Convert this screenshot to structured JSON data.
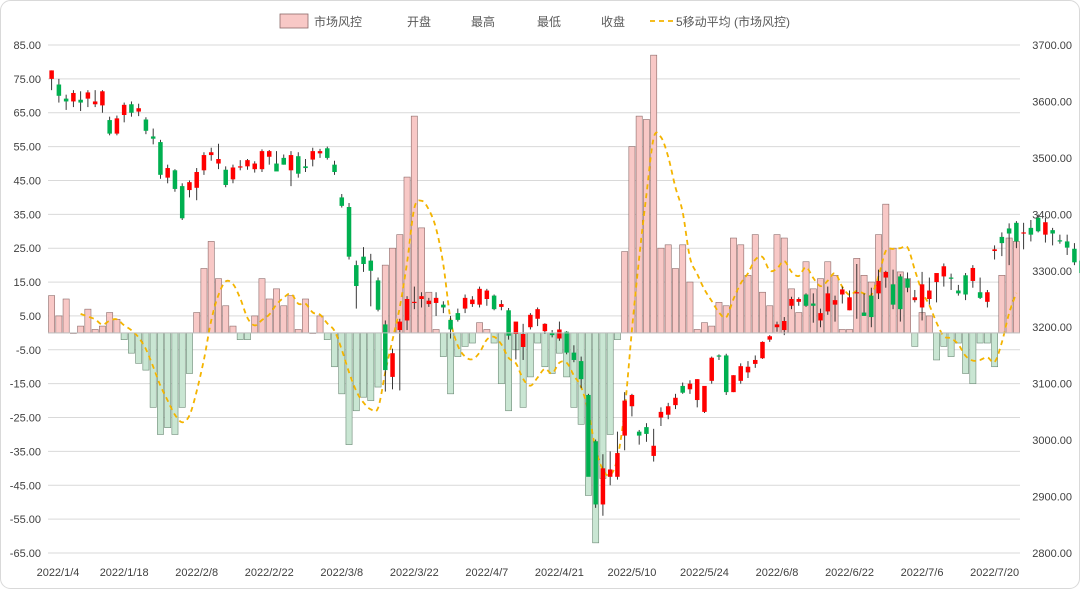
{
  "chart_data": {
    "type": "bar",
    "legend_position": "top",
    "grid": true,
    "legend": [
      {
        "key": "risk",
        "label": "市场风控",
        "kind": "bar"
      },
      {
        "key": "open",
        "label": "开盘",
        "kind": "none"
      },
      {
        "key": "high",
        "label": "最高",
        "kind": "none"
      },
      {
        "key": "low",
        "label": "最低",
        "kind": "none"
      },
      {
        "key": "close",
        "label": "收盘",
        "kind": "none"
      },
      {
        "key": "ma5",
        "label": "5移动平均 (市场风控)",
        "kind": "dash"
      }
    ],
    "y_left": {
      "min": -65,
      "max": 85,
      "step": 10,
      "ticks": [
        "-65.00",
        "-55.00",
        "-45.00",
        "-35.00",
        "-25.00",
        "-15.00",
        "-5.00",
        "5.00",
        "15.00",
        "25.00",
        "35.00",
        "45.00",
        "55.00",
        "65.00",
        "75.00",
        "85.00"
      ]
    },
    "y_right": {
      "min": 2800,
      "max": 3700,
      "step": 100,
      "ticks": [
        "2800.00",
        "2900.00",
        "3000.00",
        "3100.00",
        "3200.00",
        "3300.00",
        "3400.00",
        "3500.00",
        "3600.00",
        "3700.00"
      ]
    },
    "x_tick_labels": [
      {
        "label": "2022/1/4",
        "index": 0
      },
      {
        "label": "2022/1/18",
        "index": 10
      },
      {
        "label": "2022/2/8",
        "index": 20
      },
      {
        "label": "2022/2/22",
        "index": 30
      },
      {
        "label": "2022/3/8",
        "index": 40
      },
      {
        "label": "2022/3/22",
        "index": 50
      },
      {
        "label": "2022/4/7",
        "index": 60
      },
      {
        "label": "2022/4/21",
        "index": 70
      },
      {
        "label": "2022/5/10",
        "index": 80
      },
      {
        "label": "2022/5/24",
        "index": 90
      },
      {
        "label": "2022/6/8",
        "index": 100
      },
      {
        "label": "2022/6/22",
        "index": 110
      },
      {
        "label": "2022/7/6",
        "index": 120
      },
      {
        "label": "2022/7/20",
        "index": 130
      }
    ],
    "risk": [
      11,
      5,
      10,
      0,
      2,
      7,
      1,
      2,
      6,
      4,
      -2,
      -6,
      -9,
      -11,
      -22,
      -30,
      -28,
      -30,
      -22,
      -12,
      6,
      19,
      27,
      16,
      8,
      2,
      -2,
      -2,
      5,
      16,
      10,
      13,
      8,
      11,
      1,
      10,
      0,
      5,
      -2,
      -10,
      -18,
      -33,
      -23,
      -19,
      -20,
      -16,
      20,
      25,
      29,
      46,
      64,
      31,
      12,
      1,
      -7,
      -18,
      -7,
      -4,
      -3,
      3,
      1,
      -3,
      -15,
      -23,
      -5,
      -22,
      -13,
      -3,
      -10,
      -12,
      -6,
      -13,
      -22,
      -27,
      -48,
      -62,
      -43,
      -30,
      -2,
      24,
      55,
      64,
      63,
      82,
      25,
      26,
      19,
      26,
      15,
      1,
      3,
      2,
      9,
      8,
      28,
      26,
      17,
      29,
      12,
      8,
      29,
      28,
      13,
      6,
      21,
      13,
      16,
      21,
      17,
      1,
      1,
      22,
      17,
      15,
      29,
      38,
      25,
      18,
      16,
      -4,
      6,
      5,
      -8,
      -4,
      -7,
      -3,
      -12,
      -15,
      -3,
      -3,
      -10,
      17,
      28,
      27
    ],
    "ohlc": [
      {
        "o": 3640,
        "h": 3655,
        "l": 3620,
        "c": 3655
      },
      {
        "o": 3630,
        "h": 3640,
        "l": 3598,
        "c": 3610
      },
      {
        "o": 3605,
        "h": 3612,
        "l": 3585,
        "c": 3600
      },
      {
        "o": 3600,
        "h": 3620,
        "l": 3590,
        "c": 3615
      },
      {
        "o": 3603,
        "h": 3618,
        "l": 3583,
        "c": 3598
      },
      {
        "o": 3605,
        "h": 3620,
        "l": 3590,
        "c": 3616
      },
      {
        "o": 3595,
        "h": 3620,
        "l": 3590,
        "c": 3600
      },
      {
        "o": 3593,
        "h": 3620,
        "l": 3580,
        "c": 3618
      },
      {
        "o": 3567,
        "h": 3573,
        "l": 3540,
        "c": 3543
      },
      {
        "o": 3543,
        "h": 3575,
        "l": 3540,
        "c": 3570
      },
      {
        "o": 3576,
        "h": 3598,
        "l": 3563,
        "c": 3594
      },
      {
        "o": 3595,
        "h": 3600,
        "l": 3573,
        "c": 3580
      },
      {
        "o": 3582,
        "h": 3596,
        "l": 3574,
        "c": 3588
      },
      {
        "o": 3568,
        "h": 3572,
        "l": 3542,
        "c": 3548
      },
      {
        "o": 3538,
        "h": 3552,
        "l": 3524,
        "c": 3534
      },
      {
        "o": 3528,
        "h": 3532,
        "l": 3463,
        "c": 3470
      },
      {
        "o": 3465,
        "h": 3488,
        "l": 3455,
        "c": 3482
      },
      {
        "o": 3478,
        "h": 3480,
        "l": 3440,
        "c": 3445
      },
      {
        "o": 3450,
        "h": 3455,
        "l": 3390,
        "c": 3393
      },
      {
        "o": 3443,
        "h": 3460,
        "l": 3430,
        "c": 3457
      },
      {
        "o": 3447,
        "h": 3482,
        "l": 3425,
        "c": 3475
      },
      {
        "o": 3478,
        "h": 3510,
        "l": 3470,
        "c": 3505
      },
      {
        "o": 3505,
        "h": 3518,
        "l": 3495,
        "c": 3510
      },
      {
        "o": 3490,
        "h": 3525,
        "l": 3480,
        "c": 3498
      },
      {
        "o": 3479,
        "h": 3485,
        "l": 3448,
        "c": 3452
      },
      {
        "o": 3462,
        "h": 3488,
        "l": 3455,
        "c": 3483
      },
      {
        "o": 3484,
        "h": 3496,
        "l": 3478,
        "c": 3485
      },
      {
        "o": 3485,
        "h": 3498,
        "l": 3479,
        "c": 3496
      },
      {
        "o": 3480,
        "h": 3494,
        "l": 3474,
        "c": 3490
      },
      {
        "o": 3480,
        "h": 3515,
        "l": 3475,
        "c": 3512
      },
      {
        "o": 3502,
        "h": 3514,
        "l": 3488,
        "c": 3512
      },
      {
        "o": 3490,
        "h": 3512,
        "l": 3478,
        "c": 3476
      },
      {
        "o": 3500,
        "h": 3506,
        "l": 3488,
        "c": 3488
      },
      {
        "o": 3478,
        "h": 3512,
        "l": 3450,
        "c": 3505
      },
      {
        "o": 3503,
        "h": 3510,
        "l": 3465,
        "c": 3472
      },
      {
        "o": 3485,
        "h": 3498,
        "l": 3475,
        "c": 3482
      },
      {
        "o": 3497,
        "h": 3518,
        "l": 3485,
        "c": 3512
      },
      {
        "o": 3508,
        "h": 3516,
        "l": 3500,
        "c": 3512
      },
      {
        "o": 3517,
        "h": 3520,
        "l": 3497,
        "c": 3500
      },
      {
        "o": 3488,
        "h": 3495,
        "l": 3470,
        "c": 3475
      },
      {
        "o": 3430,
        "h": 3436,
        "l": 3412,
        "c": 3415
      },
      {
        "o": 3413,
        "h": 3420,
        "l": 3320,
        "c": 3325
      },
      {
        "o": 3310,
        "h": 3318,
        "l": 3233,
        "c": 3273
      },
      {
        "o": 3325,
        "h": 3342,
        "l": 3298,
        "c": 3312
      },
      {
        "o": 3318,
        "h": 3330,
        "l": 3237,
        "c": 3300
      },
      {
        "o": 3283,
        "h": 3288,
        "l": 3228,
        "c": 3231
      },
      {
        "o": 3205,
        "h": 3212,
        "l": 3086,
        "c": 3124
      },
      {
        "o": 3112,
        "h": 3162,
        "l": 3090,
        "c": 3154
      },
      {
        "o": 3195,
        "h": 3215,
        "l": 3088,
        "c": 3210
      },
      {
        "o": 3212,
        "h": 3255,
        "l": 3195,
        "c": 3250
      },
      {
        "o": 3243,
        "h": 3272,
        "l": 3232,
        "c": 3245
      },
      {
        "o": 3250,
        "h": 3262,
        "l": 3235,
        "c": 3255
      },
      {
        "o": 3241,
        "h": 3252,
        "l": 3236,
        "c": 3247
      },
      {
        "o": 3243,
        "h": 3262,
        "l": 3220,
        "c": 3252
      },
      {
        "o": 3240,
        "h": 3246,
        "l": 3225,
        "c": 3235
      },
      {
        "o": 3213,
        "h": 3220,
        "l": 3180,
        "c": 3196
      },
      {
        "o": 3225,
        "h": 3233,
        "l": 3210,
        "c": 3213
      },
      {
        "o": 3233,
        "h": 3258,
        "l": 3225,
        "c": 3252
      },
      {
        "o": 3241,
        "h": 3255,
        "l": 3236,
        "c": 3249
      },
      {
        "o": 3240,
        "h": 3272,
        "l": 3235,
        "c": 3268
      },
      {
        "o": 3250,
        "h": 3268,
        "l": 3238,
        "c": 3265
      },
      {
        "o": 3256,
        "h": 3258,
        "l": 3230,
        "c": 3232
      },
      {
        "o": 3236,
        "h": 3248,
        "l": 3230,
        "c": 3241
      },
      {
        "o": 3230,
        "h": 3234,
        "l": 3178,
        "c": 3185
      },
      {
        "o": 3188,
        "h": 3205,
        "l": 3143,
        "c": 3210
      },
      {
        "o": 3165,
        "h": 3206,
        "l": 3142,
        "c": 3188
      },
      {
        "o": 3200,
        "h": 3225,
        "l": 3196,
        "c": 3222
      },
      {
        "o": 3215,
        "h": 3235,
        "l": 3202,
        "c": 3232
      },
      {
        "o": 3193,
        "h": 3207,
        "l": 3188,
        "c": 3206
      },
      {
        "o": 3190,
        "h": 3195,
        "l": 3182,
        "c": 3186
      },
      {
        "o": 3180,
        "h": 3210,
        "l": 3176,
        "c": 3196
      },
      {
        "o": 3192,
        "h": 3193,
        "l": 3152,
        "c": 3155
      },
      {
        "o": 3155,
        "h": 3168,
        "l": 3138,
        "c": 3142
      },
      {
        "o": 3140,
        "h": 3148,
        "l": 3092,
        "c": 3108
      },
      {
        "o": 3080,
        "h": 3082,
        "l": 2990,
        "c": 2935
      },
      {
        "o": 2998,
        "h": 3001,
        "l": 2880,
        "c": 2886
      },
      {
        "o": 2886,
        "h": 2975,
        "l": 2866,
        "c": 2950
      },
      {
        "o": 2935,
        "h": 2980,
        "l": 2920,
        "c": 2948
      },
      {
        "o": 2935,
        "h": 3015,
        "l": 2930,
        "c": 2977
      },
      {
        "o": 3008,
        "h": 3085,
        "l": 2982,
        "c": 3070
      },
      {
        "o": 3060,
        "h": 3082,
        "l": 3042,
        "c": 3080
      },
      {
        "o": 3015,
        "h": 3018,
        "l": 2992,
        "c": 3008
      },
      {
        "o": 3023,
        "h": 3030,
        "l": 2997,
        "c": 3011
      },
      {
        "o": 2972,
        "h": 3020,
        "l": 2962,
        "c": 2990
      },
      {
        "o": 3040,
        "h": 3058,
        "l": 3025,
        "c": 3050
      },
      {
        "o": 3045,
        "h": 3066,
        "l": 3037,
        "c": 3060
      },
      {
        "o": 3062,
        "h": 3082,
        "l": 3055,
        "c": 3075
      },
      {
        "o": 3096,
        "h": 3102,
        "l": 3082,
        "c": 3084
      },
      {
        "o": 3090,
        "h": 3106,
        "l": 3082,
        "c": 3100
      },
      {
        "o": 3071,
        "h": 3108,
        "l": 3058,
        "c": 3108
      },
      {
        "o": 3050,
        "h": 3090,
        "l": 3048,
        "c": 3096
      },
      {
        "o": 3105,
        "h": 3148,
        "l": 3100,
        "c": 3146
      },
      {
        "o": 3150,
        "h": 3152,
        "l": 3142,
        "c": 3148
      },
      {
        "o": 3150,
        "h": 3153,
        "l": 3080,
        "c": 3085
      },
      {
        "o": 3085,
        "h": 3115,
        "l": 3085,
        "c": 3115
      },
      {
        "o": 3105,
        "h": 3136,
        "l": 3100,
        "c": 3131
      },
      {
        "o": 3120,
        "h": 3140,
        "l": 3110,
        "c": 3130
      },
      {
        "o": 3135,
        "h": 3150,
        "l": 3128,
        "c": 3142
      },
      {
        "o": 3145,
        "h": 3175,
        "l": 3144,
        "c": 3174
      },
      {
        "o": 3178,
        "h": 3186,
        "l": 3174,
        "c": 3184
      },
      {
        "o": 3200,
        "h": 3210,
        "l": 3192,
        "c": 3205
      },
      {
        "o": 3195,
        "h": 3218,
        "l": 3186,
        "c": 3211
      },
      {
        "o": 3238,
        "h": 3254,
        "l": 3232,
        "c": 3250
      },
      {
        "o": 3245,
        "h": 3253,
        "l": 3238,
        "c": 3250
      },
      {
        "o": 3258,
        "h": 3260,
        "l": 3236,
        "c": 3238
      },
      {
        "o": 3242,
        "h": 3260,
        "l": 3208,
        "c": 3238
      },
      {
        "o": 3212,
        "h": 3233,
        "l": 3200,
        "c": 3225
      },
      {
        "o": 3228,
        "h": 3272,
        "l": 3222,
        "c": 3260
      },
      {
        "o": 3240,
        "h": 3256,
        "l": 3210,
        "c": 3248
      },
      {
        "o": 3258,
        "h": 3272,
        "l": 3242,
        "c": 3267
      },
      {
        "o": 3230,
        "h": 3265,
        "l": 3230,
        "c": 3253
      },
      {
        "o": 3262,
        "h": 3312,
        "l": 3215,
        "c": 3262
      },
      {
        "o": 3226,
        "h": 3260,
        "l": 3220,
        "c": 3220
      },
      {
        "o": 3256,
        "h": 3270,
        "l": 3200,
        "c": 3218
      },
      {
        "o": 3260,
        "h": 3302,
        "l": 3250,
        "c": 3282
      },
      {
        "o": 3288,
        "h": 3300,
        "l": 3270,
        "c": 3298
      },
      {
        "o": 3276,
        "h": 3302,
        "l": 3232,
        "c": 3240
      },
      {
        "o": 3290,
        "h": 3294,
        "l": 3210,
        "c": 3232
      },
      {
        "o": 3286,
        "h": 3297,
        "l": 3262,
        "c": 3270
      },
      {
        "o": 3248,
        "h": 3266,
        "l": 3244,
        "c": 3253
      },
      {
        "o": 3235,
        "h": 3298,
        "l": 3212,
        "c": 3276
      },
      {
        "o": 3250,
        "h": 3288,
        "l": 3240,
        "c": 3265
      },
      {
        "o": 3280,
        "h": 3295,
        "l": 3244,
        "c": 3296
      },
      {
        "o": 3290,
        "h": 3313,
        "l": 3272,
        "c": 3308
      },
      {
        "o": 3288,
        "h": 3295,
        "l": 3266,
        "c": 3286
      },
      {
        "o": 3265,
        "h": 3275,
        "l": 3256,
        "c": 3260
      },
      {
        "o": 3292,
        "h": 3296,
        "l": 3248,
        "c": 3258
      },
      {
        "o": 3282,
        "h": 3310,
        "l": 3270,
        "c": 3305
      },
      {
        "o": 3262,
        "h": 3288,
        "l": 3250,
        "c": 3252
      },
      {
        "o": 3245,
        "h": 3266,
        "l": 3235,
        "c": 3262
      },
      {
        "o": 3335,
        "h": 3345,
        "l": 3320,
        "c": 3338
      },
      {
        "o": 3360,
        "h": 3368,
        "l": 3326,
        "c": 3349
      },
      {
        "o": 3375,
        "h": 3384,
        "l": 3310,
        "c": 3366
      },
      {
        "o": 3385,
        "h": 3388,
        "l": 3340,
        "c": 3352
      },
      {
        "o": 3368,
        "h": 3385,
        "l": 3338,
        "c": 3368
      },
      {
        "o": 3376,
        "h": 3390,
        "l": 3352,
        "c": 3364
      },
      {
        "o": 3394,
        "h": 3400,
        "l": 3368,
        "c": 3370
      },
      {
        "o": 3364,
        "h": 3394,
        "l": 3350,
        "c": 3386
      },
      {
        "o": 3372,
        "h": 3376,
        "l": 3345,
        "c": 3366
      },
      {
        "o": 3354,
        "h": 3364,
        "l": 3348,
        "c": 3352
      },
      {
        "o": 3352,
        "h": 3364,
        "l": 3328,
        "c": 3341
      },
      {
        "o": 3339,
        "h": 3349,
        "l": 3310,
        "c": 3315
      },
      {
        "o": 3318,
        "h": 3322,
        "l": 3292,
        "c": 3296
      },
      {
        "o": 3296,
        "h": 3305,
        "l": 3288,
        "c": 3302
      },
      {
        "o": 3298,
        "h": 3310,
        "l": 3288,
        "c": 3300
      },
      {
        "o": 3290,
        "h": 3305,
        "l": 3275,
        "c": 3284
      },
      {
        "o": 3306,
        "h": 3316,
        "l": 3284,
        "c": 3300
      },
      {
        "o": 3282,
        "h": 3315,
        "l": 3270,
        "c": 3288
      }
    ]
  }
}
